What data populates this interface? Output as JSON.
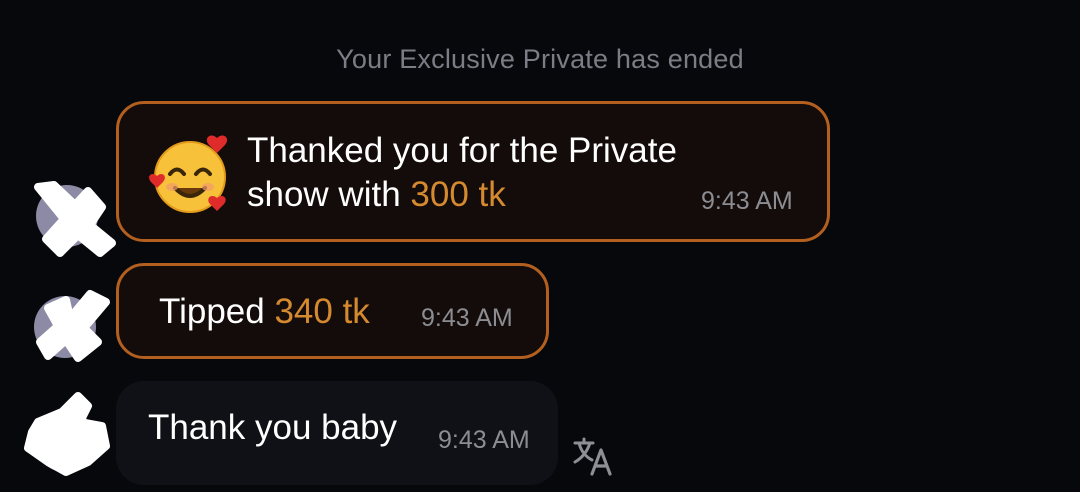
{
  "system_message": "Your Exclusive Private has ended",
  "messages": [
    {
      "line1": "Thanked you for the Private",
      "line2_prefix": "show with ",
      "amount": "300 tk",
      "time": "9:43 AM",
      "emoji": "smiling-face-with-hearts-icon"
    },
    {
      "prefix": "Tipped ",
      "amount": "340 tk",
      "time": "9:43 AM"
    },
    {
      "text": "Thank you baby",
      "time": "9:43 AM",
      "action_icon": "translate-icon"
    }
  ],
  "colors": {
    "background": "#07080c",
    "tip_border": "#b25f1f",
    "amount": "#d68a2f",
    "muted_text": "#7c7d84"
  }
}
